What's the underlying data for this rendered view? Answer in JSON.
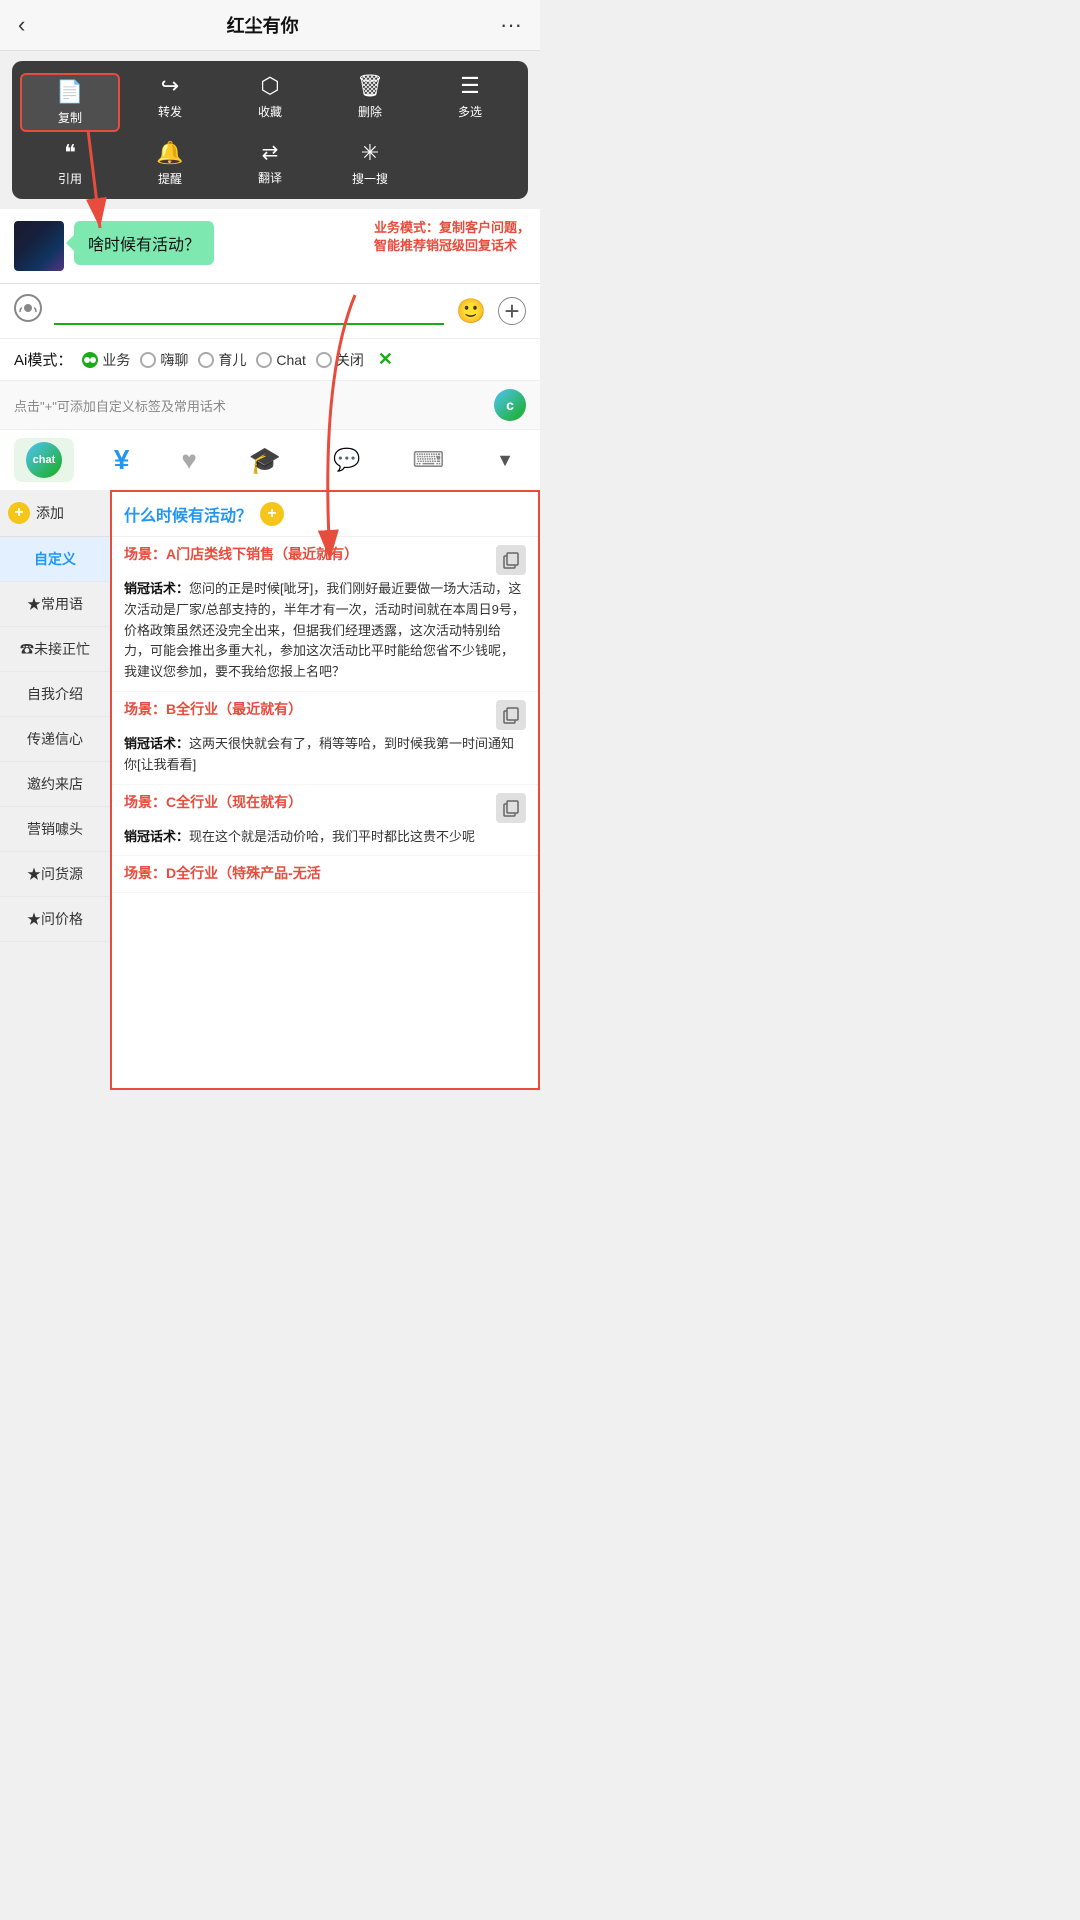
{
  "header": {
    "back_label": "‹",
    "title": "红尘有你",
    "more_label": "···"
  },
  "context_menu": {
    "row1": [
      {
        "icon": "📄",
        "label": "复制",
        "highlighted": true
      },
      {
        "icon": "↪",
        "label": "转发",
        "highlighted": false
      },
      {
        "icon": "🎁",
        "label": "收藏",
        "highlighted": false
      },
      {
        "icon": "🗑",
        "label": "删除",
        "highlighted": false
      },
      {
        "icon": "☰",
        "label": "多选",
        "highlighted": false
      }
    ],
    "row2": [
      {
        "icon": "❝",
        "label": "引用"
      },
      {
        "icon": "🔔",
        "label": "提醒"
      },
      {
        "icon": "🔄",
        "label": "翻译"
      },
      {
        "icon": "✳",
        "label": "搜一搜"
      }
    ]
  },
  "chat": {
    "bubble_text": "啥时候有活动？",
    "annotation": "业务模式：复制客户问题，\n智能推荐销冠级回复话术"
  },
  "input_area": {
    "placeholder": "",
    "voice_icon": "📢",
    "emoji_icon": "🙂",
    "plus_icon": "+"
  },
  "ai_modes": {
    "label": "Ai模式：",
    "options": [
      {
        "label": "业务",
        "active": true
      },
      {
        "label": "嗨聊",
        "active": false
      },
      {
        "label": "育儿",
        "active": false
      },
      {
        "label": "Chat",
        "active": false
      },
      {
        "label": "关闭",
        "active": false
      }
    ],
    "close_icon": "✕"
  },
  "tips_bar": {
    "text": "点击\"+\"可添加自定义标签及常用话术"
  },
  "toolbar": {
    "items": [
      {
        "icon": "🤖",
        "label": "chat",
        "type": "badge",
        "active": true
      },
      {
        "icon": "¥",
        "label": "yuan",
        "active": false
      },
      {
        "icon": "♥",
        "label": "heart",
        "active": false
      },
      {
        "icon": "🎓",
        "label": "hat",
        "active": false
      },
      {
        "icon": "chat",
        "label": "chat-text",
        "active": false
      },
      {
        "icon": "⌨",
        "label": "keyboard",
        "active": false
      },
      {
        "icon": "▼",
        "label": "down",
        "active": false
      }
    ]
  },
  "sidebar": {
    "add_label": "添加",
    "items": [
      {
        "label": "自定义",
        "active": true
      },
      {
        "label": "★常用语",
        "active": false
      },
      {
        "label": "☎未接正忙",
        "active": false
      },
      {
        "label": "自我介绍",
        "active": false
      },
      {
        "label": "传递信心",
        "active": false
      },
      {
        "label": "邀约来店",
        "active": false
      },
      {
        "label": "营销噱头",
        "active": false
      },
      {
        "label": "★问货源",
        "active": false
      },
      {
        "label": "★问价格",
        "active": false
      }
    ]
  },
  "content": {
    "question": "什么时候有活动？",
    "scenarios": [
      {
        "title": "场景：A门店类线下销售（最近就有）",
        "content": "销冠话术：您问的正是时候[呲牙]，我们刚好最近要做一场大活动，这次活动是厂家/总部支持的，半年才有一次，活动时间就在本周日9号，价格政策虽然还没完全出来，但据我们经理透露，这次活动特别给力，可能会推出多重大礼，参加这次活动比平时能给您省不少钱呢，我建议您参加，要不我给您报上名吧？"
      },
      {
        "title": "场景：B全行业（最近就有）",
        "content": "销冠话术：这两天很快就会有了，稍等等哈，到时候我第一时间通知你[让我看看]"
      },
      {
        "title": "场景：C全行业（现在就有）",
        "content": "销冠话术：现在这个就是活动价哈，我们平时都比这贵不少呢"
      },
      {
        "title": "场景：D全行业（特殊产品-无活",
        "content": ""
      }
    ]
  }
}
